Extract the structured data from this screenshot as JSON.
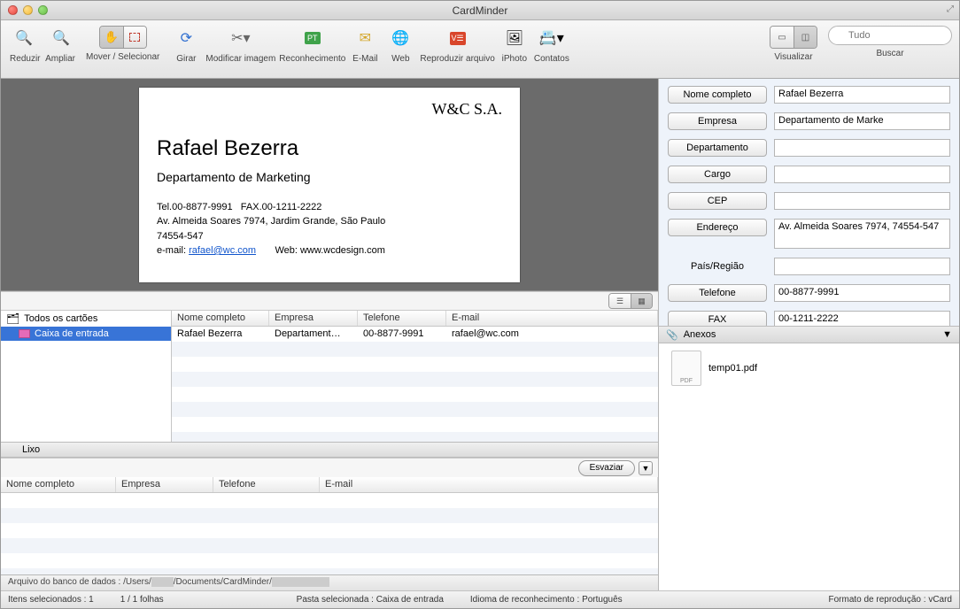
{
  "window": {
    "title": "CardMinder"
  },
  "toolbar": {
    "reduzir": "Reduzir",
    "ampliar": "Ampliar",
    "mover_selecionar": "Mover / Selecionar",
    "girar": "Girar",
    "modificar_imagem": "Modificar imagem",
    "reconhecimento": "Reconhecimento",
    "email": "E-Mail",
    "web": "Web",
    "reproduzir_arquivo": "Reproduzir arquivo",
    "iphoto": "iPhoto",
    "contatos": "Contatos",
    "visualizar": "Visualizar",
    "buscar": "Buscar"
  },
  "search": {
    "placeholder": "Tudo"
  },
  "card": {
    "company": "W&C S.A.",
    "name": "Rafael Bezerra",
    "department": "Departamento de Marketing",
    "tel_label": "Tel.00-8877-9991",
    "fax_label": "FAX.00-1211-2222",
    "address_line": "Av. Almeida Soares 7974, Jardim Grande, São Paulo",
    "zip": "74554-547",
    "email_prefix": "e-mail: ",
    "email": "rafael@wc.com",
    "web_label": "Web: www.wcdesign.com"
  },
  "sidebar": {
    "all_cards": "Todos os cartões",
    "inbox": "Caixa de entrada",
    "trash": "Lixo"
  },
  "columns": {
    "nome": "Nome completo",
    "empresa": "Empresa",
    "telefone": "Telefone",
    "email": "E-mail"
  },
  "rows": [
    {
      "nome": "Rafael Bezerra",
      "empresa": "Departament…",
      "telefone": "00-8877-9991",
      "email": "rafael@wc.com"
    }
  ],
  "trash": {
    "esvaziar": "Esvaziar"
  },
  "detail": {
    "labels": {
      "nome": "Nome completo",
      "empresa": "Empresa",
      "departamento": "Departamento",
      "cargo": "Cargo",
      "cep": "CEP",
      "endereco": "Endereço",
      "pais": "País/Região",
      "telefone": "Telefone",
      "fax": "FAX"
    },
    "values": {
      "nome": "Rafael Bezerra",
      "empresa": "Departamento de Marke",
      "departamento": "",
      "cargo": "",
      "cep": "",
      "endereco": "Av. Almeida Soares 7974, 74554-547",
      "pais": "",
      "telefone": "00-8877-9991",
      "fax": "00-1211-2222"
    }
  },
  "attachments": {
    "header": "Anexos",
    "items": [
      {
        "name": "temp01.pdf"
      }
    ]
  },
  "status": {
    "db_prefix": "Arquivo do banco de dados : /Users/",
    "db_mid": "/Documents/CardMinder/",
    "itens": "Itens selecionados : 1",
    "folhas": "1 / 1 folhas",
    "pasta": "Pasta selecionada : Caixa de entrada",
    "idioma": "Idioma de reconhecimento : Português",
    "formato": "Formato de reprodução : vCard"
  }
}
